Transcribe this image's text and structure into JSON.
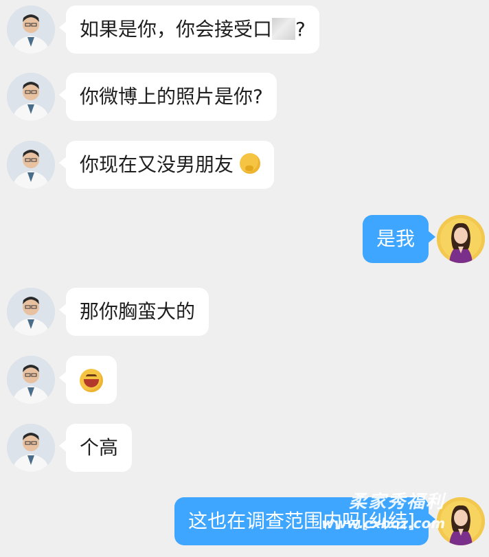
{
  "colors": {
    "background": "#efefef",
    "incoming_bubble": "#ffffff",
    "outgoing_bubble": "#3ea6ff"
  },
  "messages": [
    {
      "sender": "other",
      "parts": [
        {
          "type": "text",
          "value": "如果是你，你会接受口"
        },
        {
          "type": "blur"
        },
        {
          "type": "text",
          "value": "?"
        }
      ]
    },
    {
      "sender": "other",
      "text": "你微博上的照片是你?"
    },
    {
      "sender": "other",
      "text": "你现在又没男朋友",
      "emoji": "thinking-face-icon"
    },
    {
      "sender": "me",
      "text": "是我"
    },
    {
      "sender": "other",
      "text": "那你胸蛮大的"
    },
    {
      "sender": "other",
      "emoji": "laughing-face-icon"
    },
    {
      "sender": "other",
      "text": "个高"
    },
    {
      "sender": "me",
      "text": "这也在调查范围内吗[纠结]"
    }
  ],
  "watermark": {
    "line1": "柔家秀福利",
    "line2": "www.cxboz.com"
  }
}
